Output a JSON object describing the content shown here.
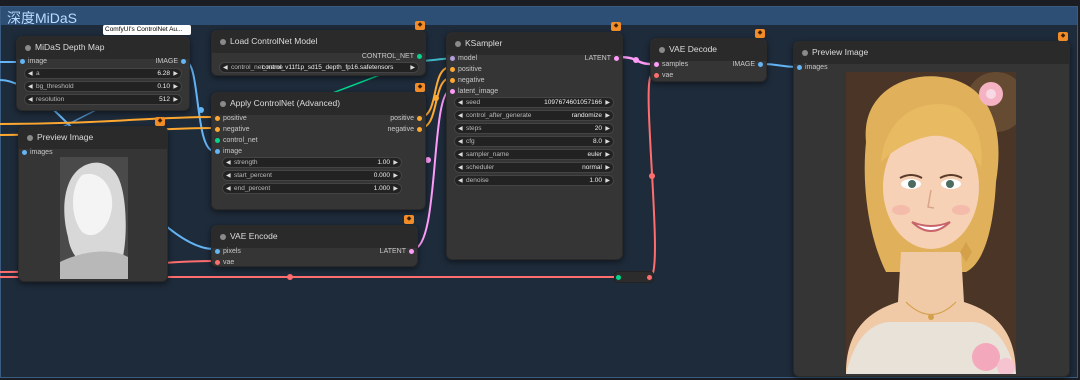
{
  "group": {
    "title": "深度MiDaS"
  },
  "tooltip": "ComfyUI's ControlNet Au...",
  "colors": {
    "image": "#64b5f6",
    "latent": "#ff9cf9",
    "conditioning": "#ffa931",
    "control_net": "#00d78d",
    "vae": "#ff6e6e",
    "model": "#b39ddb",
    "badge": "#f28c28"
  },
  "nodes": {
    "midas": {
      "title": "MiDaS Depth Map",
      "input_image": "image",
      "output_image": "IMAGE",
      "widgets": [
        {
          "label": "a",
          "value": "6.28"
        },
        {
          "label": "bg_threshold",
          "value": "0.10"
        },
        {
          "label": "resolution",
          "value": "512"
        }
      ]
    },
    "preview1": {
      "title": "Preview Image",
      "input_images": "images"
    },
    "load_cn": {
      "title": "Load ControlNet Model",
      "output": "CONTROL_NET",
      "widget": {
        "label": "control_net_name",
        "value": "control_v11f1p_sd15_depth_fp16.safetensors"
      }
    },
    "apply_cn": {
      "title": "Apply ControlNet (Advanced)",
      "inputs": [
        "positive",
        "negative",
        "control_net",
        "image"
      ],
      "outputs": [
        "positive",
        "negative"
      ],
      "widgets": [
        {
          "label": "strength",
          "value": "1.00"
        },
        {
          "label": "start_percent",
          "value": "0.000"
        },
        {
          "label": "end_percent",
          "value": "1.000"
        }
      ]
    },
    "vae_encode": {
      "title": "VAE Encode",
      "inputs": [
        "pixels",
        "vae"
      ],
      "output": "LATENT"
    },
    "ksampler": {
      "title": "KSampler",
      "inputs": [
        "model",
        "positive",
        "negative",
        "latent_image"
      ],
      "output": "LATENT",
      "widgets": [
        {
          "label": "seed",
          "value": "1097674601057166"
        },
        {
          "label": "control_after_generate",
          "value": "randomize"
        },
        {
          "label": "steps",
          "value": "20"
        },
        {
          "label": "cfg",
          "value": "8.0"
        },
        {
          "label": "sampler_name",
          "value": "euler"
        },
        {
          "label": "scheduler",
          "value": "normal"
        },
        {
          "label": "denoise",
          "value": "1.00"
        }
      ]
    },
    "vae_decode": {
      "title": "VAE Decode",
      "inputs": [
        "samples",
        "vae"
      ],
      "output": "IMAGE"
    },
    "preview2": {
      "title": "Preview Image",
      "input_images": "images"
    }
  }
}
